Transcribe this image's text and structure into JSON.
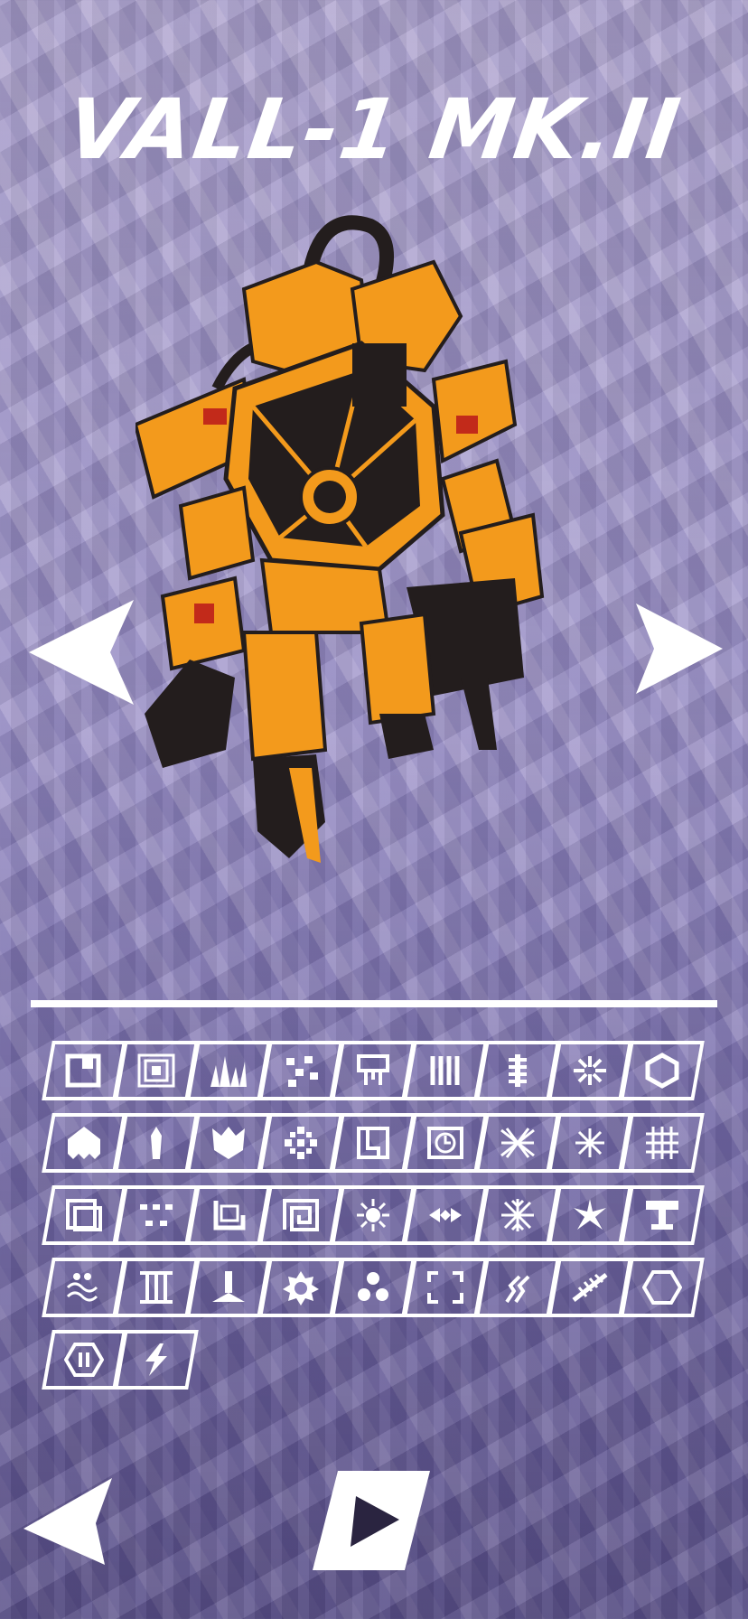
{
  "title": "VALL-1 MK.II",
  "robot": {
    "name": "robot-model",
    "color": "#f39a1c",
    "dark": "#231d1d"
  },
  "navigation": {
    "prev_icon": "triangle-left-icon",
    "next_icon": "triangle-right-icon",
    "back_icon": "triangle-left-icon",
    "play_icon": "play-icon"
  },
  "emblems": [
    "square-notch-icon",
    "concentric-squares-icon",
    "spikes-icon",
    "scattered-blocks-icon",
    "circuit-chip-icon",
    "vertical-bars-icon",
    "spine-icon",
    "burst-icon",
    "hexagon-knot-icon",
    "house-claw-icon",
    "blade-icon",
    "crown-shield-icon",
    "snowflake-icon",
    "gear-box-icon",
    "clock-box-icon",
    "tangle-icon",
    "sparkle-icon",
    "hash-grid-icon",
    "stacked-boxes-icon",
    "dotted-rows-icon",
    "seat-icon",
    "spiral-square-icon",
    "sun-icon",
    "diamond-arrows-icon",
    "ice-crystal-icon",
    "shard-burst-icon",
    "anvil-icon",
    "wave-dots-icon",
    "roman-three-icon",
    "drop-stand-icon",
    "spiked-ring-icon",
    "triple-blob-icon",
    "corner-brackets-icon",
    "zigzag-icon",
    "feather-icon",
    "hexagon-outline-icon",
    "hexagon-two-icon",
    "lightning-icon"
  ]
}
